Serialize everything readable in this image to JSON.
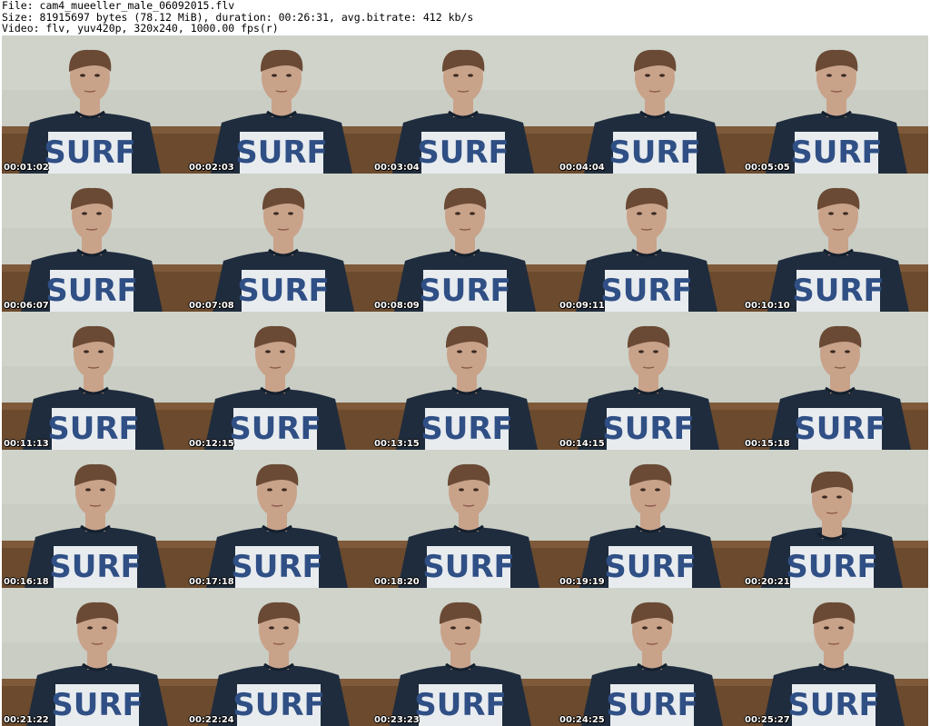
{
  "header": {
    "line1": "File: cam4_mueeller_male_06092015.flv",
    "line2": "Size: 81915697 bytes (78.12 MiB), duration: 00:26:31, avg.bitrate: 412 kb/s",
    "line3": "Video: flv, yuv420p, 320x240, 1000.00 fps(r)"
  },
  "shirt_text": "SURF",
  "thumbnails": [
    {
      "time": "00:01:02"
    },
    {
      "time": "00:02:03"
    },
    {
      "time": "00:03:04"
    },
    {
      "time": "00:04:04"
    },
    {
      "time": "00:05:05"
    },
    {
      "time": "00:06:07"
    },
    {
      "time": "00:07:08"
    },
    {
      "time": "00:08:09"
    },
    {
      "time": "00:09:11"
    },
    {
      "time": "00:10:10"
    },
    {
      "time": "00:11:13"
    },
    {
      "time": "00:12:15"
    },
    {
      "time": "00:13:15"
    },
    {
      "time": "00:14:15"
    },
    {
      "time": "00:15:18"
    },
    {
      "time": "00:16:18"
    },
    {
      "time": "00:17:18"
    },
    {
      "time": "00:18:20"
    },
    {
      "time": "00:19:19"
    },
    {
      "time": "00:20:21"
    },
    {
      "time": "00:21:22"
    },
    {
      "time": "00:22:24"
    },
    {
      "time": "00:23:23"
    },
    {
      "time": "00:24:25"
    },
    {
      "time": "00:25:27"
    }
  ],
  "colors": {
    "wall": "#c9cdc4",
    "couch": "#6b4a2e",
    "skin": "#c9a28a",
    "hair": "#6a4a35",
    "shirt": "#1f2c3d",
    "print_bg": "#e8ecef",
    "print_text": "#2f4f85"
  }
}
